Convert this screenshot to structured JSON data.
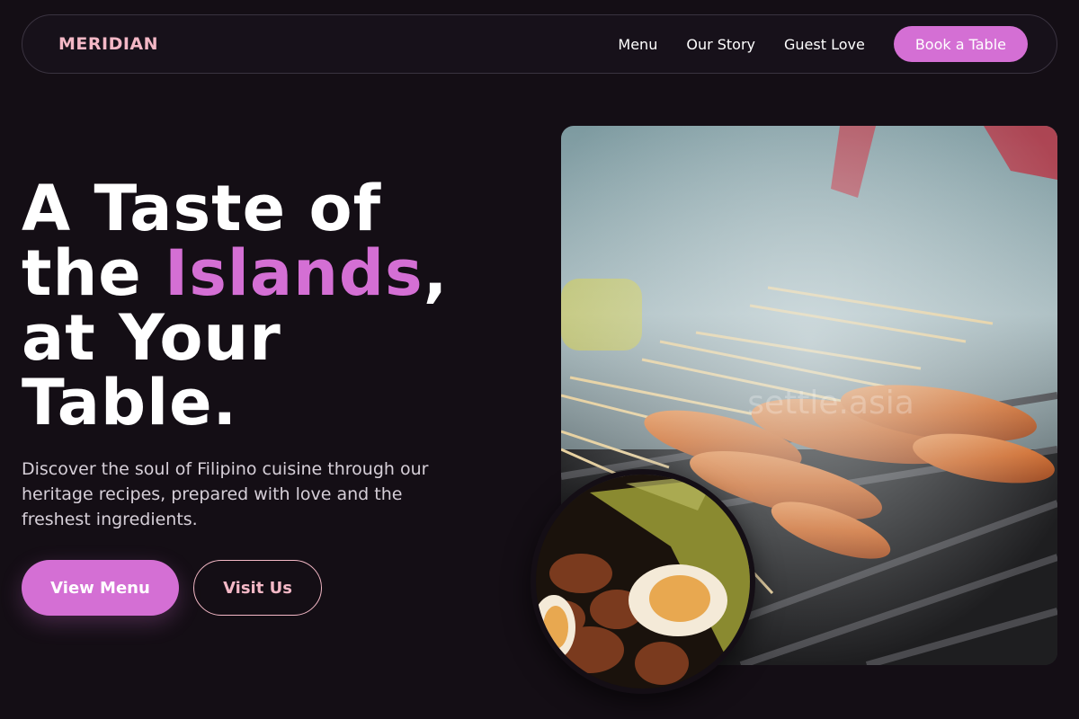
{
  "nav": {
    "brand": "MERIDIAN",
    "links": [
      "Menu",
      "Our Story",
      "Guest Love"
    ],
    "cta": "Book a Table"
  },
  "hero": {
    "title_line1": "A Taste of",
    "title_the": "the ",
    "title_accent": "Islands",
    "title_comma": ",",
    "title_line3": "at Your",
    "title_line4": "Table.",
    "subtitle": "Discover the soul of Filipino cuisine through our heritage recipes, prepared with love and the freshest ingredients.",
    "primary_button": "View Menu",
    "secondary_button": "Visit Us"
  },
  "images": {
    "main_photo": "grilled-skewers-photo",
    "round_photo": "adobo-bowl-photo",
    "watermark": "settle.asia"
  },
  "colors": {
    "background": "#140e15",
    "accent": "#d46fd4",
    "brand_pink": "#f4b8c6"
  }
}
